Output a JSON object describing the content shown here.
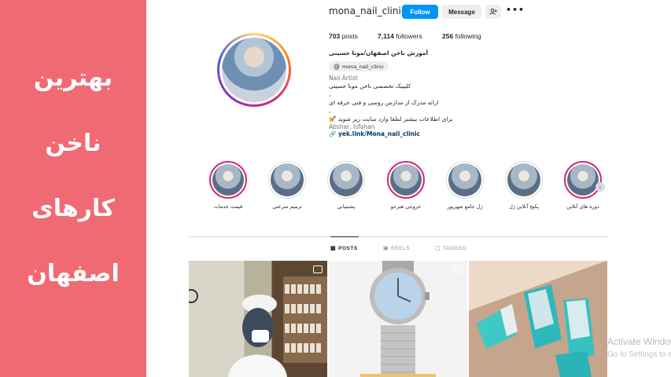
{
  "banner": {
    "line1": "بهترین",
    "line2": "ناخن",
    "line3": "کارهای",
    "line4": "اصفهان"
  },
  "profile": {
    "username": "mona_nail_clinic",
    "follow_label": "Follow",
    "message_label": "Message",
    "stats": {
      "posts_count": "703",
      "posts_label": "posts",
      "followers_count": "7,114",
      "followers_label": "followers",
      "following_count": "256",
      "following_label": "following"
    },
    "bio": {
      "name": "آموزش ناخن اصفهان/مونا حسینی",
      "threads_handle": "mona_nail_clinic",
      "category": "Nail Artist",
      "line1": "کلینیک تخصصی ناخن مونا حسینی",
      "line2": ",",
      "line3": "ارائه مدرک از مدارس روسی و فنی حرفه ای",
      "line4": ",",
      "line5": "برای اطلاعات بیشتر لطفا وارد سایت زیر شوید",
      "location": "Abshar, Isfahan",
      "link": "yek.link/Mona_nail_clinic"
    }
  },
  "highlights": [
    {
      "label": "قیمت خدمات"
    },
    {
      "label": "ترمیم سرعتی"
    },
    {
      "label": "پشتیبانی"
    },
    {
      "label": "خروجی هنرجو"
    },
    {
      "label": "ژل جامع شهریور"
    },
    {
      "label": "پکیج آنلاین ژل"
    },
    {
      "label": "دوره های آنلاین"
    }
  ],
  "tabs": {
    "posts": "POSTS",
    "reels": "REELS",
    "tagged": "TAGGED"
  },
  "watermark": {
    "line1": "Activate Window",
    "line2": "Go to Settings to activ"
  },
  "colors": {
    "banner_bg": "#f06a74",
    "follow_blue": "#0095f6",
    "link_color": "#00376b"
  }
}
